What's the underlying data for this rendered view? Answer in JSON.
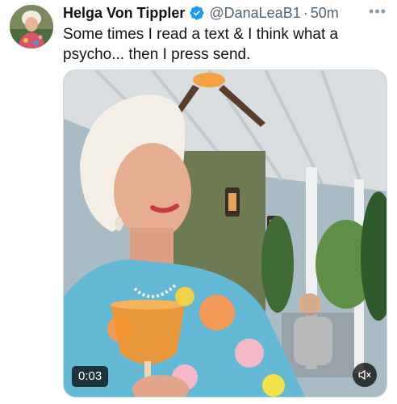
{
  "tweet": {
    "display_name": "Helga Von Tippler",
    "handle": "@DanaLeaB1",
    "separator": "·",
    "time": "50m",
    "text": "Some times I read a text & I think what a psycho... then I press send.",
    "more_icon": "ellipsis-icon",
    "verified_icon": "verified-badge-icon",
    "verified_color": "#1d9bf0"
  },
  "media": {
    "type": "video",
    "timestamp": "0:03",
    "mute_icon": "speaker-icon"
  }
}
